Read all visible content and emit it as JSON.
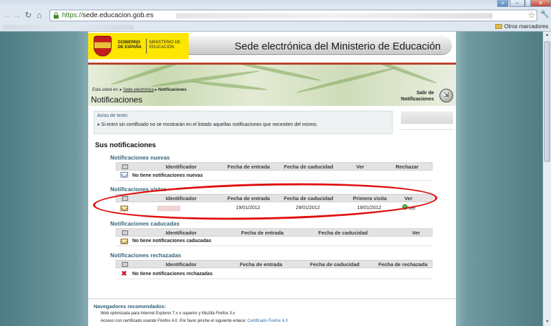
{
  "browser": {
    "url_host": "https://sede.educacion.gob.es",
    "bookmarks_other": "Otros marcadores",
    "icons": [
      "back-icon",
      "forward-icon",
      "reload-icon",
      "home-icon",
      "lock-icon",
      "star-icon",
      "wrench-icon",
      "folder-icon"
    ]
  },
  "header": {
    "gov_label": "GOBIERNO DE ESPAÑA",
    "ministry_label": "MINISTERIO DE EDUCACIÓN",
    "site_title": "Sede electrónica del Ministerio de Educación",
    "accent_color": "#b8412a"
  },
  "banner": {
    "breadcrumb_prefix": "Está usted en:",
    "breadcrumb_link": "Sede electrónica",
    "breadcrumb_current": "Notificaciones",
    "page_title": "Notificaciones",
    "exit_line1": "Salir de",
    "exit_line2": "Notificaciones"
  },
  "notice": {
    "heading": "Aviso de texto",
    "body": "Si entró sin certificado no se mostrarán en el listado aquellas notificaciones que necesiten del mismo."
  },
  "main_heading": "Sus notificaciones",
  "sections": {
    "nuevas": {
      "title": "Notificaciones nuevas",
      "columns": [
        "Identificador",
        "Fecha de entrada",
        "Fecha de caducidad",
        "Ver",
        "Rechazar"
      ],
      "empty": "No tiene notificaciones nuevas"
    },
    "vistas": {
      "title": "Notificaciones vistas",
      "columns": [
        "Identificador",
        "Fecha de entrada",
        "Fecha de caducidad",
        "Primera visita",
        "Ver"
      ],
      "rows": [
        {
          "fecha_entrada": "19/01/2012",
          "fecha_caducidad": "29/01/2012",
          "primera_visita": "19/01/2012",
          "ver": "Ver"
        }
      ]
    },
    "caducadas": {
      "title": "Notificaciones caducadas",
      "columns": [
        "Identificador",
        "Fecha de entrada",
        "Fecha de caducidad",
        "Ver"
      ],
      "empty": "No tiene notificaciones caducadas"
    },
    "rechazadas": {
      "title": "Notificaciones rechazadas",
      "columns": [
        "Identificador",
        "Fecha de entrada",
        "Fecha de caducidad",
        "Fecha de rechazada"
      ],
      "empty": "No tiene notificaciones rechazadas"
    }
  },
  "footer": {
    "heading": "Navegadores recomendados:",
    "line1": "Web optimizada para Internet Explorer 7.x o superior y Mozilla Firefox 3.x",
    "line2": "Acceso con certificado usando Firefox 4.0. Por favor pinche el siguiente enlace:",
    "link": "Certificado Firefox 4.0"
  },
  "annotation_color": "#e01010"
}
